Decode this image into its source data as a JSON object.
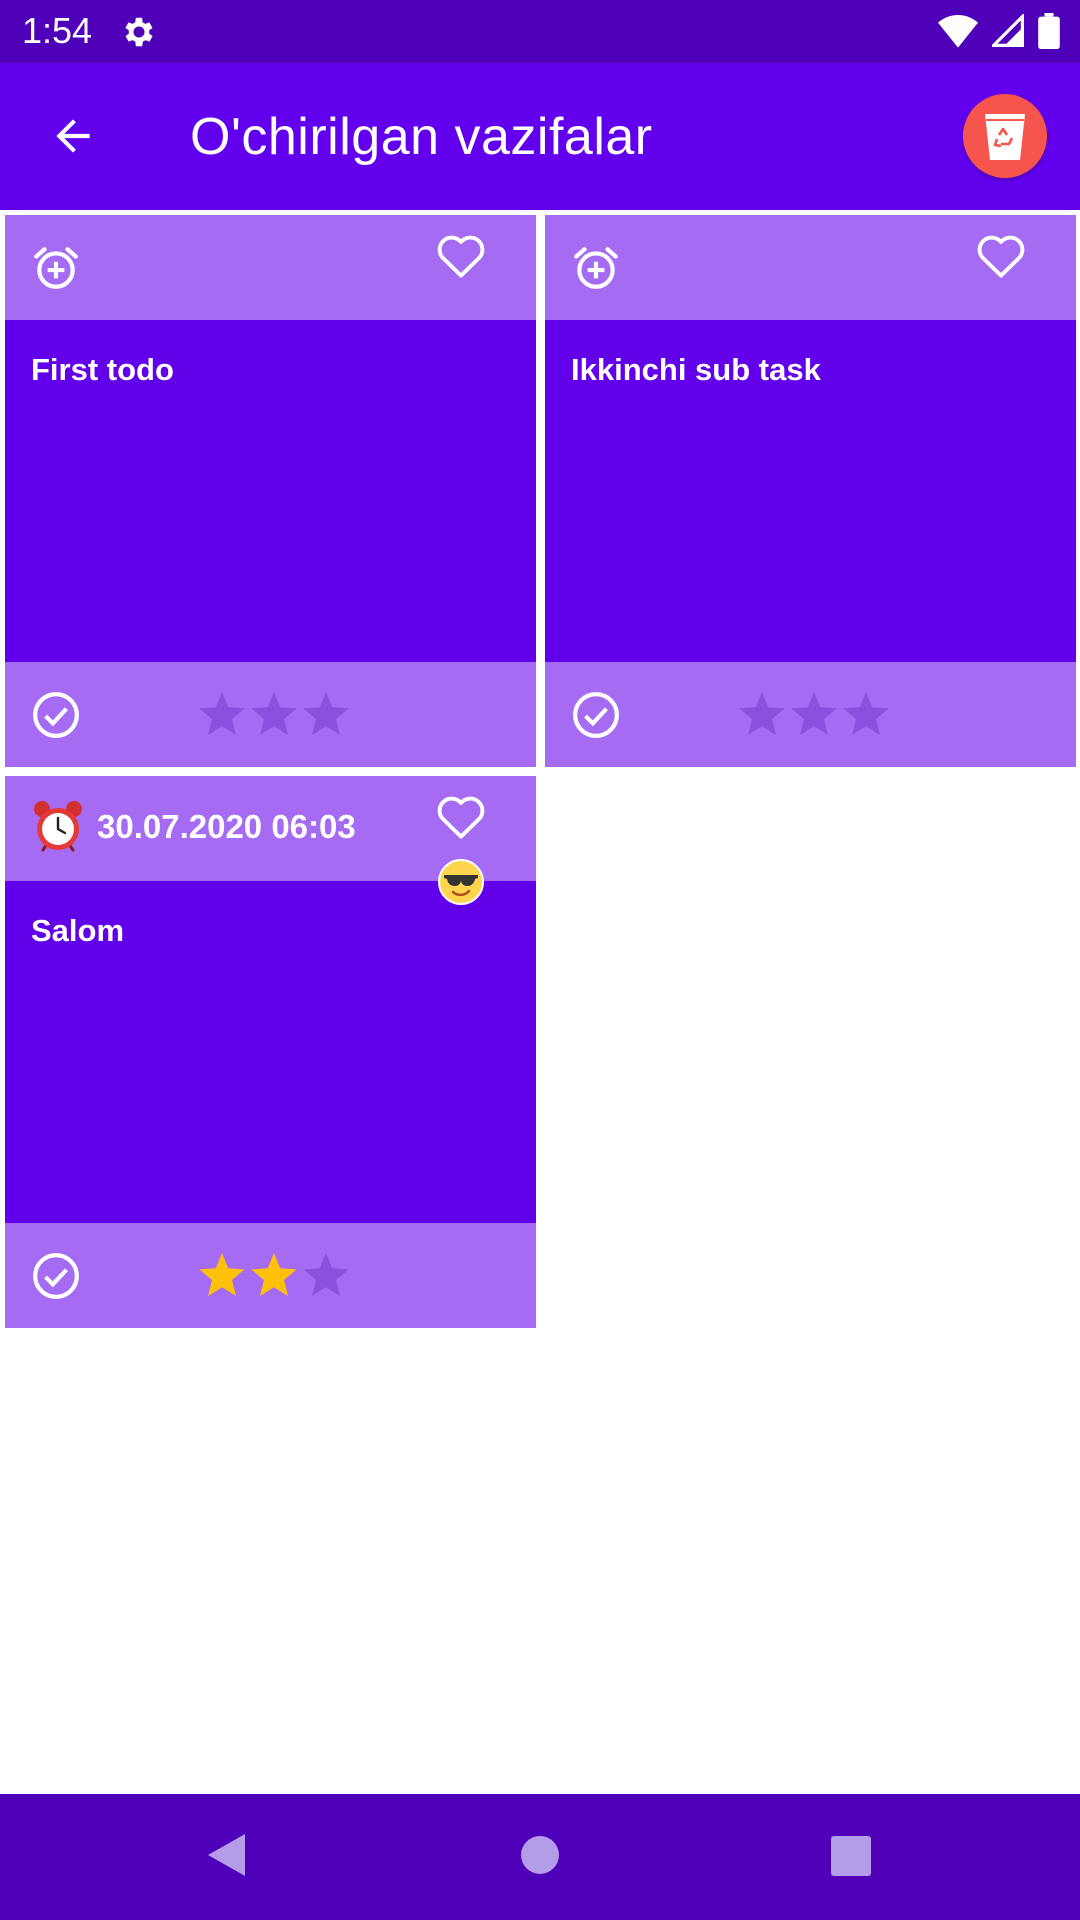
{
  "status_bar": {
    "time": "1:54"
  },
  "app_bar": {
    "title": "O'chirilgan vazifalar"
  },
  "cards": [
    {
      "title": "First todo",
      "date": "",
      "stars_filled": 0,
      "stars_total": 3
    },
    {
      "title": "Ikkinchi sub task",
      "date": "",
      "stars_filled": 0,
      "stars_total": 3
    },
    {
      "title": "Salom",
      "date": "30.07.2020 06:03",
      "stars_filled": 2,
      "stars_total": 3
    }
  ],
  "colors": {
    "status_bar": "#4f00b9",
    "app_bar": "#6200ee",
    "card_body": "#6200ea",
    "card_band": "#a56cf3",
    "trash_button": "#f6554e",
    "star_filled": "#ffc107",
    "star_empty": "#8a52dc"
  },
  "icons": {
    "status": [
      "settings-icon",
      "wifi-icon",
      "signal-icon",
      "battery-icon"
    ],
    "app_bar": [
      "arrow-back-icon",
      "recycle-bin-icon"
    ],
    "card": [
      "alarm-add-icon",
      "heart-outline-icon",
      "check-circle-icon",
      "star-icon",
      "alarm-clock-emoji-icon",
      "sunglasses-emoji-icon"
    ],
    "nav": [
      "nav-back-icon",
      "nav-home-icon",
      "nav-recents-icon"
    ]
  }
}
